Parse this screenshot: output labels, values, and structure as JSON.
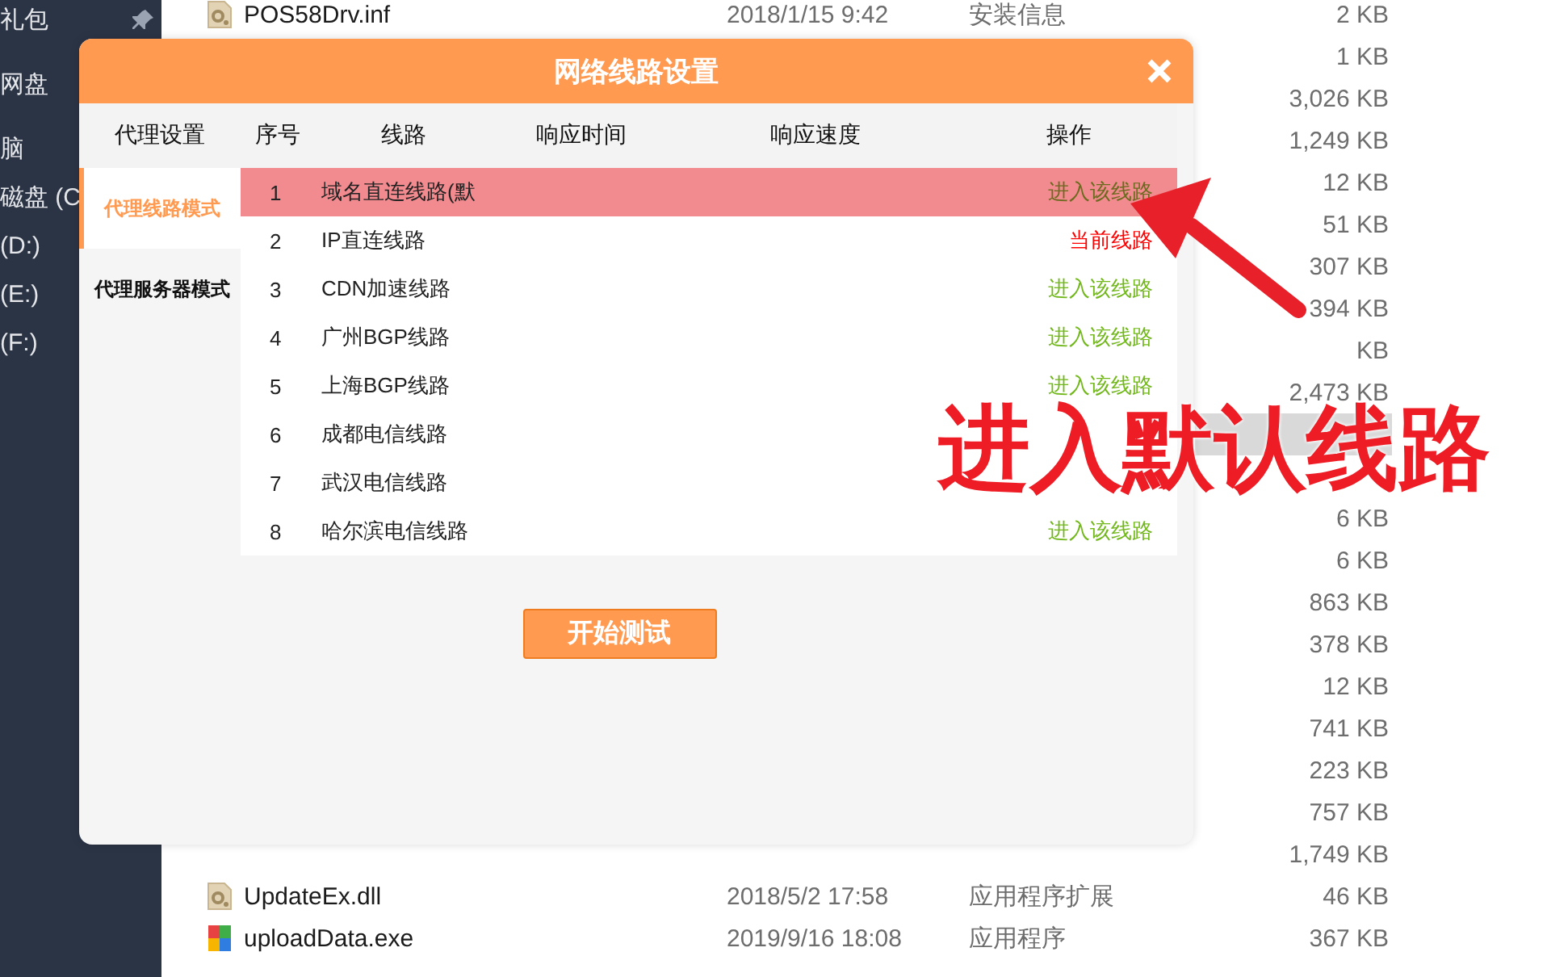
{
  "sidebar": {
    "items": [
      {
        "label": "礼包",
        "pinned": true
      },
      {
        "label": "网盘"
      },
      {
        "label": "脑"
      },
      {
        "label": "磁盘 (C"
      },
      {
        "label": "(D:)"
      },
      {
        "label": "(E:)"
      },
      {
        "label": "(F:)"
      }
    ]
  },
  "files": {
    "rows": [
      {
        "kind": "config",
        "name": "POS58Drv.inf",
        "date": "2018/1/15 9:42",
        "type": "安装信息",
        "size": "2 KB",
        "selected": false
      },
      {
        "size": "1 KB",
        "selected": false
      },
      {
        "size": "3,026 KB",
        "selected": false
      },
      {
        "size": "1,249 KB",
        "selected": false
      },
      {
        "size": "12 KB",
        "selected": false
      },
      {
        "size": "51 KB",
        "selected": false
      },
      {
        "size": "307 KB",
        "selected": false
      },
      {
        "size": "394 KB",
        "selected": false
      },
      {
        "size": "KB",
        "selected": false
      },
      {
        "size": "2,473 KB",
        "selected": false
      },
      {
        "selected": true
      },
      {
        "selected": false
      },
      {
        "size": "6 KB",
        "selected": false
      },
      {
        "size": "6 KB",
        "selected": false
      },
      {
        "size": "863 KB",
        "selected": false
      },
      {
        "size": "378 KB",
        "selected": false
      },
      {
        "size": "12 KB",
        "selected": false
      },
      {
        "size": "741 KB",
        "selected": false
      },
      {
        "size": "223 KB",
        "selected": false
      },
      {
        "size": "757 KB",
        "selected": false
      },
      {
        "size": "1,749 KB",
        "selected": false
      },
      {
        "kind": "config",
        "name": "UpdateEx.dll",
        "date": "2018/5/2 17:58",
        "type": "应用程序扩展",
        "size": "46 KB",
        "selected": false
      },
      {
        "kind": "app",
        "name": "uploadData.exe",
        "date": "2019/9/16 18:08",
        "type": "应用程序",
        "size": "367 KB",
        "selected": false
      }
    ]
  },
  "dialog": {
    "title": "网络线路设置",
    "nav": {
      "heading": "代理设置",
      "items": [
        {
          "label": "代理线路模式",
          "selected": true
        },
        {
          "label": "代理服务器模式",
          "selected": false
        }
      ]
    },
    "table": {
      "columns": [
        "序号",
        "线路",
        "响应时间",
        "响应速度",
        "操作"
      ],
      "rows": [
        {
          "index": "1",
          "line": "域名直连线路(默",
          "action": "进入该线路",
          "kind": "enter",
          "highlighted": true
        },
        {
          "index": "2",
          "line": "IP直连线路",
          "action": "当前线路",
          "kind": "current",
          "highlighted": false
        },
        {
          "index": "3",
          "line": "CDN加速线路",
          "action": "进入该线路",
          "kind": "enter",
          "highlighted": false
        },
        {
          "index": "4",
          "line": "广州BGP线路",
          "action": "进入该线路",
          "kind": "enter",
          "highlighted": false
        },
        {
          "index": "5",
          "line": "上海BGP线路",
          "action": "进入该线路",
          "kind": "enter",
          "highlighted": false
        },
        {
          "index": "6",
          "line": "成都电信线路",
          "highlighted": false
        },
        {
          "index": "7",
          "line": "武汉电信线路",
          "highlighted": false
        },
        {
          "index": "8",
          "line": "哈尔滨电信线路",
          "action": "进入该线路",
          "kind": "enter",
          "highlighted": false
        }
      ]
    },
    "button": "开始测试"
  },
  "annotation": {
    "text": "进入默认线路"
  }
}
